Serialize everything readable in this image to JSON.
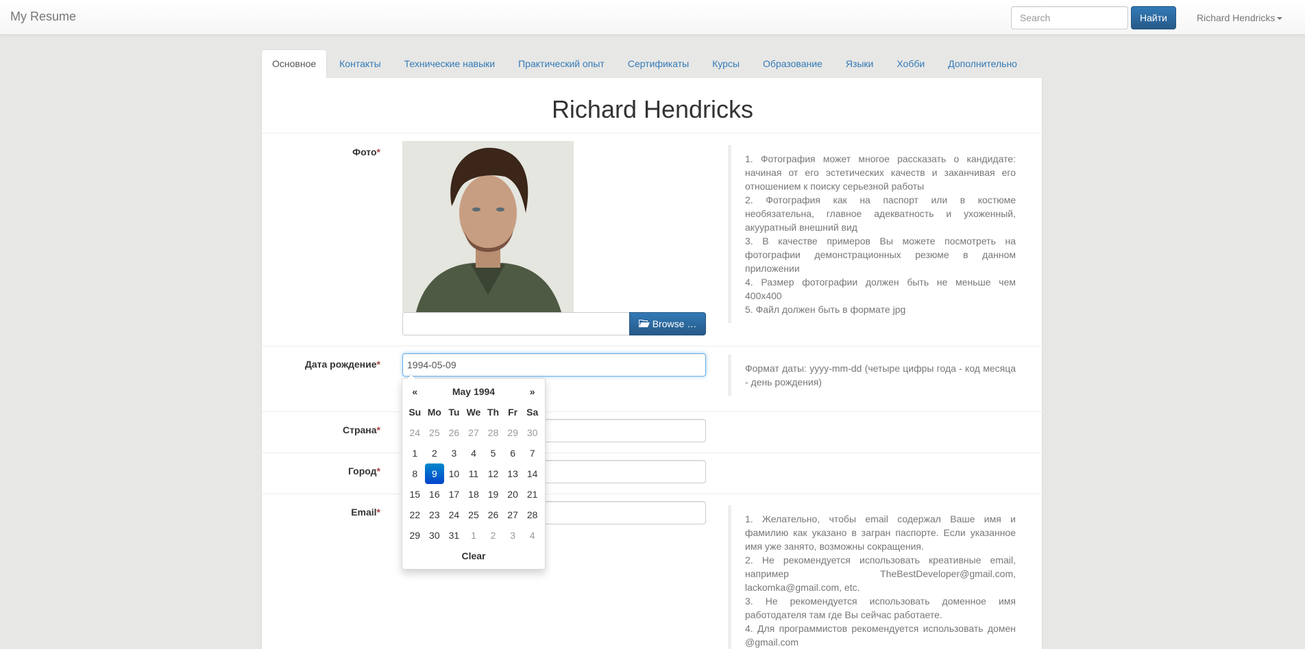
{
  "navbar": {
    "brand": "My Resume",
    "search_placeholder": "Search",
    "search_button": "Найти",
    "user_name": "Richard Hendricks"
  },
  "tabs": [
    {
      "label": "Основное",
      "active": true
    },
    {
      "label": "Контакты"
    },
    {
      "label": "Технические навыки"
    },
    {
      "label": "Практический опыт"
    },
    {
      "label": "Сертификаты"
    },
    {
      "label": "Курсы"
    },
    {
      "label": "Образование"
    },
    {
      "label": "Языки"
    },
    {
      "label": "Хобби"
    },
    {
      "label": "Дополнительно"
    }
  ],
  "profile": {
    "full_name": "Richard Hendricks"
  },
  "form": {
    "required_mark": "*",
    "photo": {
      "label": "Фото",
      "browse_label": "Browse …",
      "help": [
        "1. Фотография может многое рассказать о кандидате: начиная от его эстетических качеств и заканчивая его отношением к поиску серьезной работы",
        "2. Фотография как на паспорт или в костюме необязательна, главное адекватность и ухоженный, акууратный внешний вид",
        "3. В качестве примеров Вы можете посмотреть на фотографии демонстрационных резюме в данном приложении",
        "4. Размер фотографии должен быть не меньше чем 400x400",
        "5. Файл должен быть в формате jpg"
      ]
    },
    "birth_date": {
      "label": "Дата рождение",
      "value": "1994-05-09",
      "help": "Формат даты: yyyy-mm-dd (четыре цифры года - код месяца - день рождения)"
    },
    "country": {
      "label": "Страна",
      "value": ""
    },
    "city": {
      "label": "Город",
      "value": ""
    },
    "email": {
      "label": "Email",
      "value": "",
      "help": [
        "1. Желательно, чтобы email содержал Ваше имя и фамилию как указано в загран паспорте. Если указанное имя уже занято, возможны сокращения.",
        "2. Не рекомендуется использовать креативные email, например TheBestDeveloper@gmail.com, lackomka@gmail.com, etc.",
        "3. Не рекомендуется использовать доменное имя работодателя там где Вы сейчас работаете.",
        "4. Для программистов рекомендуется использовать домен @gmail.com"
      ]
    }
  },
  "datepicker": {
    "prev": "«",
    "next": "»",
    "month_title": "May 1994",
    "weekdays": [
      "Su",
      "Mo",
      "Tu",
      "We",
      "Th",
      "Fr",
      "Sa"
    ],
    "weeks": [
      [
        {
          "d": "24",
          "c": "old"
        },
        {
          "d": "25",
          "c": "old"
        },
        {
          "d": "26",
          "c": "old"
        },
        {
          "d": "27",
          "c": "old"
        },
        {
          "d": "28",
          "c": "old"
        },
        {
          "d": "29",
          "c": "old"
        },
        {
          "d": "30",
          "c": "old"
        }
      ],
      [
        {
          "d": "1"
        },
        {
          "d": "2"
        },
        {
          "d": "3"
        },
        {
          "d": "4"
        },
        {
          "d": "5"
        },
        {
          "d": "6"
        },
        {
          "d": "7"
        }
      ],
      [
        {
          "d": "8"
        },
        {
          "d": "9",
          "c": "active"
        },
        {
          "d": "10"
        },
        {
          "d": "11"
        },
        {
          "d": "12"
        },
        {
          "d": "13"
        },
        {
          "d": "14"
        }
      ],
      [
        {
          "d": "15"
        },
        {
          "d": "16"
        },
        {
          "d": "17"
        },
        {
          "d": "18"
        },
        {
          "d": "19"
        },
        {
          "d": "20"
        },
        {
          "d": "21"
        }
      ],
      [
        {
          "d": "22"
        },
        {
          "d": "23"
        },
        {
          "d": "24"
        },
        {
          "d": "25"
        },
        {
          "d": "26"
        },
        {
          "d": "27"
        },
        {
          "d": "28"
        }
      ],
      [
        {
          "d": "29"
        },
        {
          "d": "30"
        },
        {
          "d": "31"
        },
        {
          "d": "1",
          "c": "new"
        },
        {
          "d": "2",
          "c": "new"
        },
        {
          "d": "3",
          "c": "new"
        },
        {
          "d": "4",
          "c": "new"
        }
      ]
    ],
    "clear_label": "Clear"
  }
}
